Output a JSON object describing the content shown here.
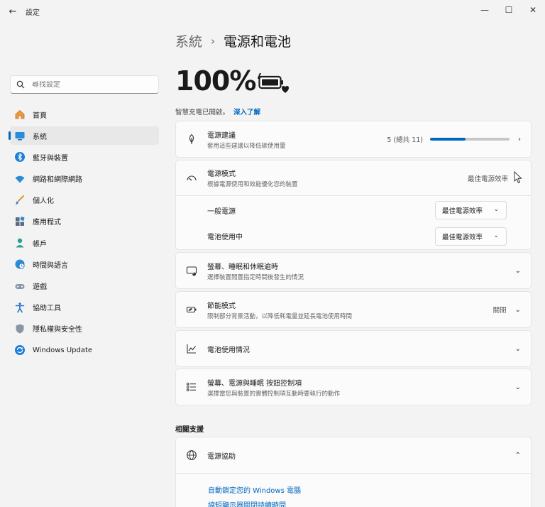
{
  "window": {
    "title": "設定"
  },
  "search": {
    "placeholder": "尋找設定"
  },
  "sidebar": {
    "items": [
      {
        "label": "首頁",
        "icon": "home-icon"
      },
      {
        "label": "系統",
        "icon": "system-icon",
        "active": true
      },
      {
        "label": "藍牙與裝置",
        "icon": "bluetooth-icon"
      },
      {
        "label": "網路和網際網路",
        "icon": "wifi-icon"
      },
      {
        "label": "個人化",
        "icon": "brush-icon"
      },
      {
        "label": "應用程式",
        "icon": "apps-icon"
      },
      {
        "label": "帳戶",
        "icon": "person-icon"
      },
      {
        "label": "時間與語言",
        "icon": "globe-clock-icon"
      },
      {
        "label": "遊戲",
        "icon": "gamepad-icon"
      },
      {
        "label": "協助工具",
        "icon": "accessibility-icon"
      },
      {
        "label": "隱私權與安全性",
        "icon": "shield-icon"
      },
      {
        "label": "Windows Update",
        "icon": "update-icon"
      }
    ]
  },
  "breadcrumb": {
    "parent": "系統",
    "separator": "›",
    "current": "電源和電池"
  },
  "battery": {
    "percent": "100%",
    "smart_charging": "智慧充電已開啟。",
    "learn_more": "深入了解"
  },
  "cards": {
    "recommendations": {
      "title": "電源建議",
      "subtitle": "套用這些建議以降低碳使用量",
      "status": "5 (總共 11)",
      "progress": 0.45
    },
    "power_mode": {
      "title": "電源模式",
      "subtitle": "根據電源使用和效能優化您的裝置",
      "value": "最佳電源效率",
      "plugged_in_label": "一般電源",
      "plugged_in_value": "最佳電源效率",
      "on_battery_label": "電池使用中",
      "on_battery_value": "最佳電源效率"
    },
    "screen_sleep": {
      "title": "螢幕、睡眠和休眠逾時",
      "subtitle": "選擇裝置閒置指定時間後發生的情況"
    },
    "energy_saver": {
      "title": "節能模式",
      "subtitle": "限制部分背景活動，以降低耗電量並延長電池使用時間",
      "value": "關閉"
    },
    "battery_usage": {
      "title": "電池使用情況"
    },
    "button_controls": {
      "title": "螢幕、電源與睡眠 按鈕控制項",
      "subtitle": "選擇當您與裝置的實體控制項互動時要執行的動作"
    }
  },
  "related_support": {
    "heading": "相關支援",
    "card_title": "電源協助",
    "links": [
      "自動鎖定您的 Windows 電腦",
      "縮短顯示器關閉持續時間"
    ]
  },
  "colors": {
    "accent": "#0067c0",
    "background": "#f3f3f3",
    "card": "#fbfbfb"
  }
}
